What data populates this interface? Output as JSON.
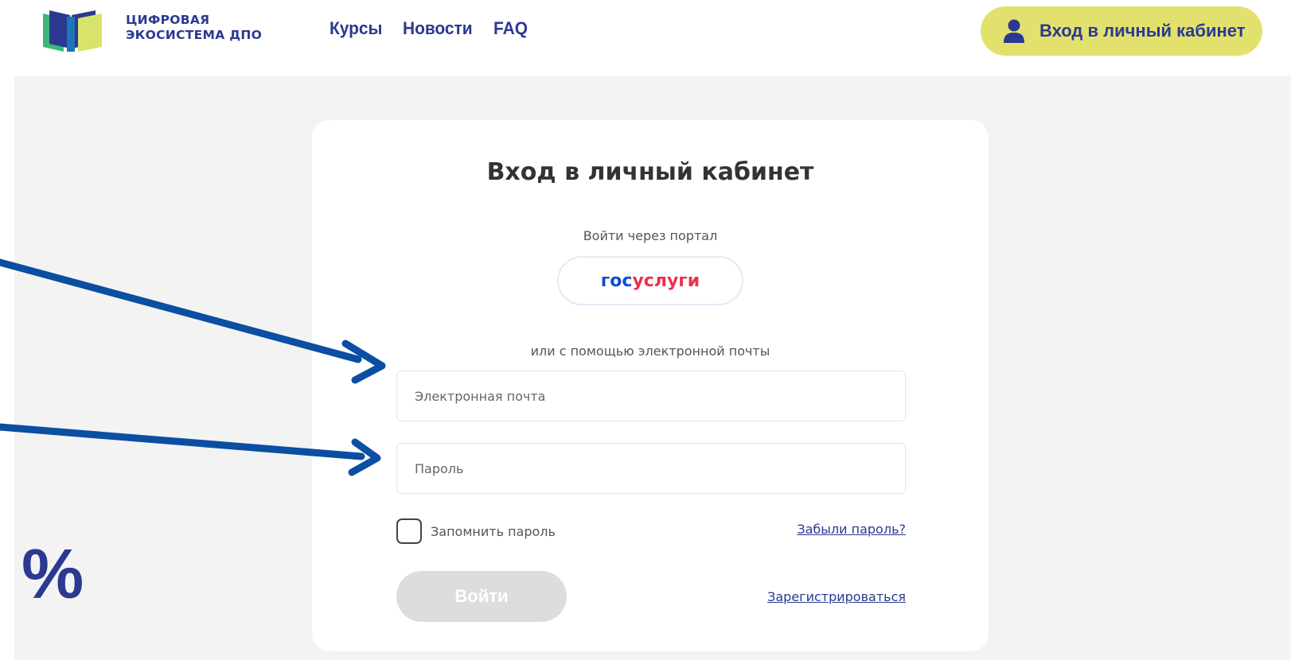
{
  "header": {
    "logo_line1": "ЦИФРОВАЯ",
    "logo_line2": "ЭКОСИСТЕМА ДПО",
    "nav": [
      {
        "label": "Курсы"
      },
      {
        "label": "Новости"
      },
      {
        "label": "FAQ"
      }
    ],
    "cabinet_button": "Вход в личный кабинет"
  },
  "login": {
    "title": "Вход в личный кабинет",
    "portal_label": "Войти через портал",
    "gosuslugi_part1": "гос",
    "gosuslugi_part2": "услуги",
    "email_label": "или с помощью электронной почты",
    "email_placeholder": "Электронная почта",
    "password_placeholder": "Пароль",
    "remember_label": "Запомнить пароль",
    "forgot_link": "Забыли пароль?",
    "submit_label": "Войти",
    "register_link": "Зарегистрироваться"
  },
  "annotation": {
    "symbol": "%"
  },
  "colors": {
    "brand_blue": "#2b3990",
    "accent_yellow": "#e3e16d",
    "gos_blue": "#0d4cd3",
    "gos_red": "#ee2f53",
    "arrow_blue": "#0b4ea2"
  }
}
